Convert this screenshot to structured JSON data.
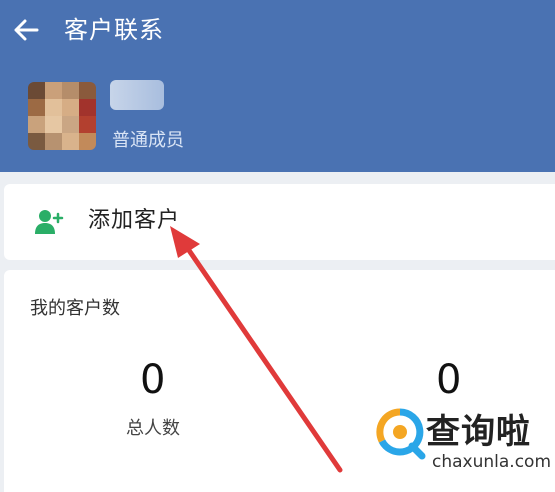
{
  "header": {
    "title": "客户联系",
    "role": "普通成员",
    "bg_color": "#4a72b2"
  },
  "add_customer": {
    "label": "添加客户",
    "icon": "add-person-icon",
    "icon_color": "#2aae67"
  },
  "stats": {
    "title": "我的客户数",
    "items": [
      {
        "value": "0",
        "label": "总人数"
      },
      {
        "value": "0",
        "label": ""
      }
    ]
  },
  "watermark": {
    "cn": "查询啦",
    "en": "chaxunla.com"
  }
}
